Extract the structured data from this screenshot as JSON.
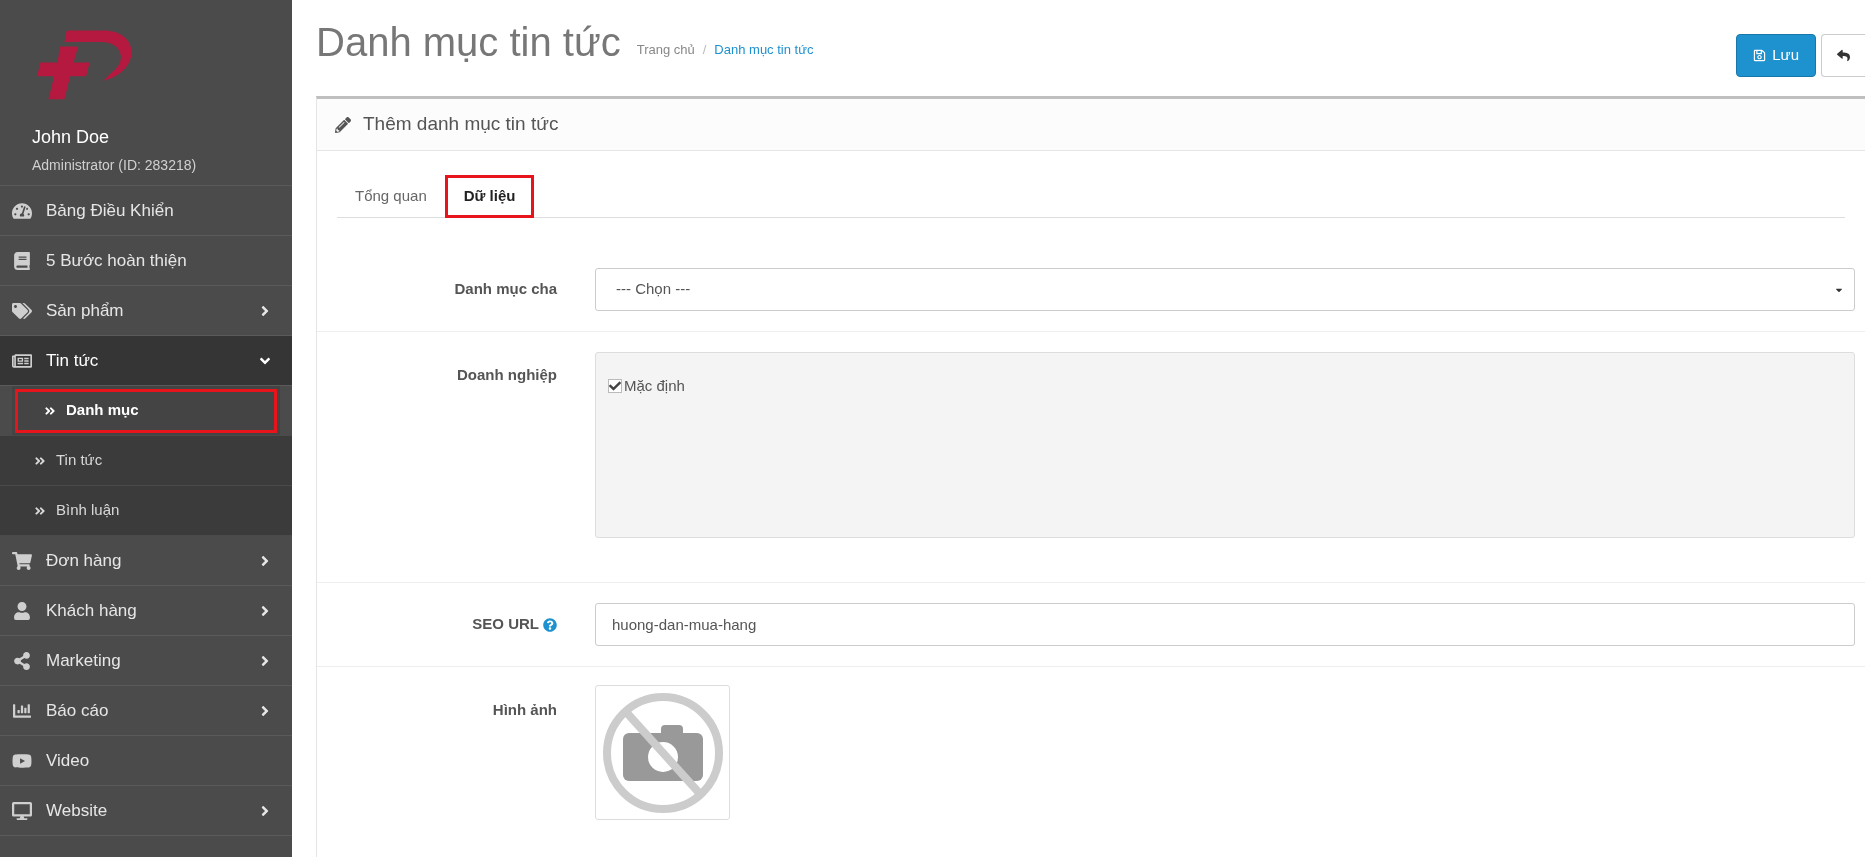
{
  "sidebar": {
    "user": {
      "name": "John Doe",
      "role": "Administrator (ID: 283218)"
    },
    "items": [
      {
        "label": "Bảng Điều Khiển",
        "has_submenu": false,
        "expanded": false
      },
      {
        "label": "5 Bước hoàn thiện",
        "has_submenu": false,
        "expanded": false
      },
      {
        "label": "Sản phẩm",
        "has_submenu": true,
        "expanded": false
      },
      {
        "label": "Tin tức",
        "has_submenu": true,
        "expanded": true,
        "children": [
          {
            "label": "Danh mục",
            "selected": true,
            "highlighted": true
          },
          {
            "label": "Tin tức",
            "selected": false,
            "highlighted": false
          },
          {
            "label": "Bình luận",
            "selected": false,
            "highlighted": false
          }
        ]
      },
      {
        "label": "Đơn hàng",
        "has_submenu": true,
        "expanded": false
      },
      {
        "label": "Khách hàng",
        "has_submenu": true,
        "expanded": false
      },
      {
        "label": "Marketing",
        "has_submenu": true,
        "expanded": false
      },
      {
        "label": "Báo cáo",
        "has_submenu": true,
        "expanded": false
      },
      {
        "label": "Video",
        "has_submenu": false,
        "expanded": false
      },
      {
        "label": "Website",
        "has_submenu": true,
        "expanded": false
      }
    ]
  },
  "header": {
    "title": "Danh mục tin tức",
    "breadcrumb": [
      "Trang chủ",
      "Danh mục tin tức"
    ],
    "breadcrumb_separator": "/",
    "save_button": "Lưu"
  },
  "panel": {
    "title": "Thêm danh mục tin tức",
    "tabs": [
      {
        "label": "Tổng quan",
        "selected": false,
        "highlighted": false
      },
      {
        "label": "Dữ liệu",
        "selected": true,
        "highlighted": true
      }
    ],
    "form": {
      "parent": {
        "label": "Danh mục cha",
        "value": "--- Chọn ---"
      },
      "business": {
        "label": "Doanh nghiệp",
        "options": [
          {
            "label": "Mặc định",
            "checked": true
          }
        ]
      },
      "seo": {
        "label": "SEO URL",
        "value": "huong-dan-mua-hang"
      },
      "image": {
        "label": "Hình ảnh"
      }
    }
  }
}
